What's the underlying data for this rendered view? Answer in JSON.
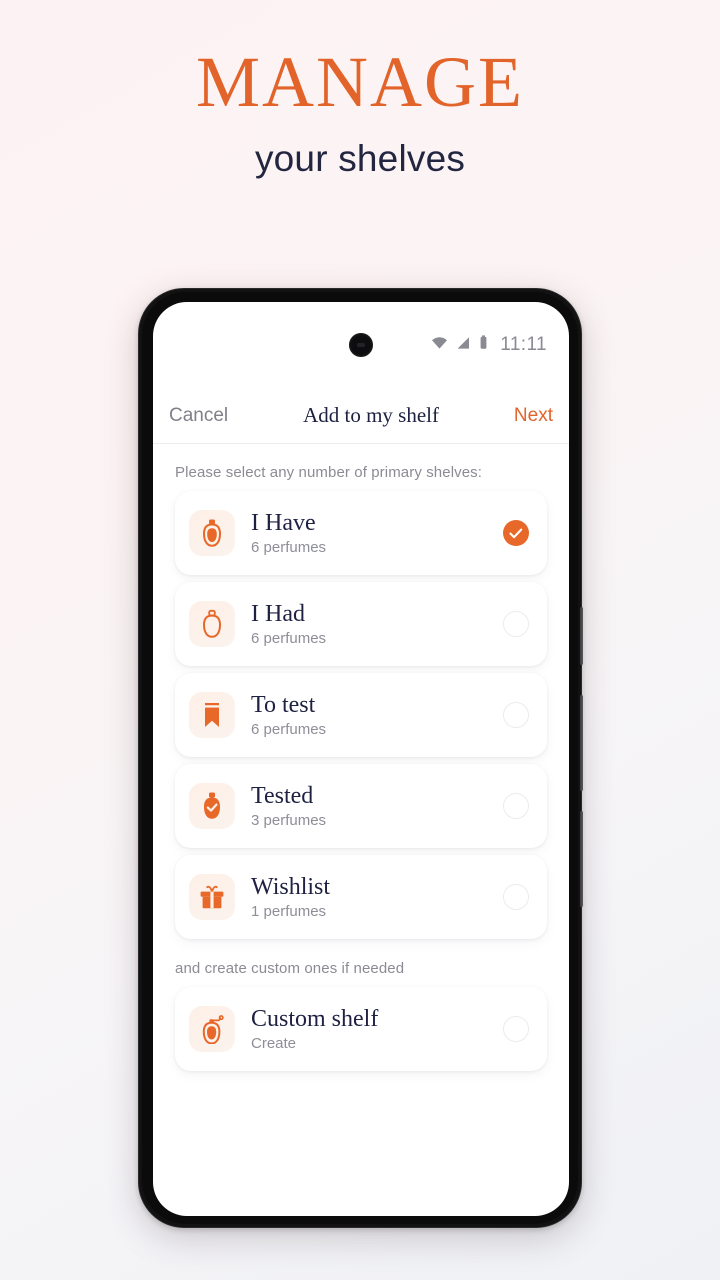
{
  "promo": {
    "headline": "MANAGE",
    "subheadline": "your shelves",
    "accent_color": "#e2642a",
    "dark_color": "#232640"
  },
  "status_bar": {
    "time": "11:11",
    "icons": [
      "wifi-icon",
      "signal-icon",
      "battery-icon"
    ]
  },
  "navbar": {
    "cancel_label": "Cancel",
    "title": "Add to my shelf",
    "next_label": "Next"
  },
  "content": {
    "primary_label": "Please select any number of primary shelves:",
    "custom_label": "and create custom ones if needed",
    "primary_shelves": [
      {
        "title": "I Have",
        "subtitle": "6 perfumes",
        "icon": "perfume-bottle-filled-icon",
        "selected": true
      },
      {
        "title": "I Had",
        "subtitle": "6 perfumes",
        "icon": "perfume-bottle-outline-icon",
        "selected": false
      },
      {
        "title": "To test",
        "subtitle": "6 perfumes",
        "icon": "bookmark-icon",
        "selected": false
      },
      {
        "title": "Tested",
        "subtitle": "3 perfumes",
        "icon": "perfume-bottle-check-icon",
        "selected": false
      },
      {
        "title": "Wishlist",
        "subtitle": "1 perfumes",
        "icon": "gift-icon",
        "selected": false
      }
    ],
    "custom_shelves": [
      {
        "title": "Custom shelf",
        "subtitle": "Create",
        "icon": "perfume-atomizer-icon",
        "selected": false
      }
    ]
  }
}
